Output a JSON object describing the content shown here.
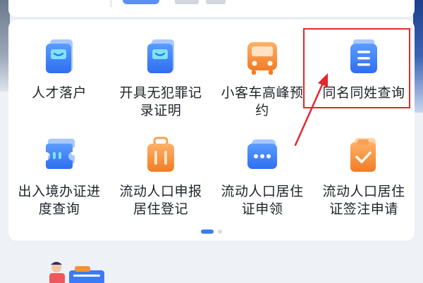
{
  "services": [
    {
      "label": "人才落户",
      "icon": "id-card-icon"
    },
    {
      "label": "开具无犯罪记录证明",
      "icon": "certificate-icon"
    },
    {
      "label": "小客车高峰预约",
      "icon": "bus-icon"
    },
    {
      "label": "同名同姓查询",
      "icon": "name-query-icon"
    },
    {
      "label": "出入境办证进度查询",
      "icon": "ticket-icon"
    },
    {
      "label": "流动人口申报居住登记",
      "icon": "luggage-icon"
    },
    {
      "label": "流动人口居住证申领",
      "icon": "message-card-icon"
    },
    {
      "label": "流动人口居住证签注申请",
      "icon": "check-clipboard-icon"
    }
  ],
  "pager": {
    "pages": 2,
    "current": 1
  },
  "colors": {
    "accent": "#3b7cf6",
    "highlight": "#e4272b",
    "orange": "#f5923a"
  }
}
